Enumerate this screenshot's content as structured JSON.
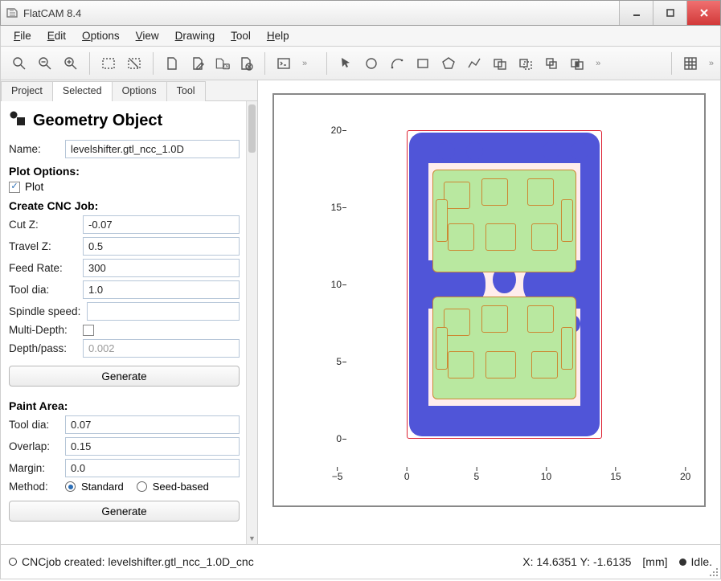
{
  "window": {
    "title": "FlatCAM 8.4"
  },
  "menu": [
    "File",
    "Edit",
    "Options",
    "View",
    "Drawing",
    "Tool",
    "Help"
  ],
  "tabs": {
    "items": [
      "Project",
      "Selected",
      "Options",
      "Tool"
    ],
    "active": 1
  },
  "panel": {
    "heading": "Geometry Object",
    "name_label": "Name:",
    "name_value": "levelshifter.gtl_ncc_1.0D",
    "plot_options": "Plot Options:",
    "plot_checkbox_label": "Plot",
    "plot_checked": true,
    "cnc_heading": "Create CNC Job:",
    "fields": {
      "cutz": {
        "label": "Cut Z:",
        "value": "-0.07"
      },
      "travz": {
        "label": "Travel Z:",
        "value": "0.5"
      },
      "feed": {
        "label": "Feed Rate:",
        "value": "300"
      },
      "tdia": {
        "label": "Tool dia:",
        "value": "1.0"
      },
      "spin": {
        "label": "Spindle speed:",
        "value": ""
      },
      "multi": {
        "label": "Multi-Depth:"
      },
      "dpp": {
        "label": "Depth/pass:",
        "value": "0.002"
      }
    },
    "generate": "Generate",
    "paint_heading": "Paint Area:",
    "paint": {
      "tdia": {
        "label": "Tool dia:",
        "value": "0.07"
      },
      "overlap": {
        "label": "Overlap:",
        "value": "0.15"
      },
      "margin": {
        "label": "Margin:",
        "value": "0.0"
      },
      "method_label": "Method:",
      "method_standard": "Standard",
      "method_seed": "Seed-based",
      "method_selected": "standard"
    },
    "generate2": "Generate"
  },
  "canvas": {
    "x_ticks": [
      -5,
      0,
      5,
      10,
      15,
      20
    ],
    "y_ticks": [
      0,
      5,
      10,
      15,
      20
    ],
    "pcb_extent": {
      "x0": 0,
      "y0": 0,
      "x1": 14,
      "y1": 20
    }
  },
  "status": {
    "message": "CNCjob created: levelshifter.gtl_ncc_1.0D_cnc",
    "coords": "X: 14.6351   Y: -1.6135",
    "units": "[mm]",
    "state": "Idle."
  },
  "toolbar_icons_left": [
    "zoom-fit-icon",
    "zoom-out-icon",
    "zoom-in-icon",
    "select-rect-icon",
    "select-clear-icon",
    "new-doc-icon",
    "edit-doc-icon",
    "doc-ok-icon",
    "doc-del-icon",
    "terminal-icon"
  ],
  "toolbar_icons_right": [
    "pointer-icon",
    "circle-icon",
    "arc-icon",
    "rect-icon",
    "polygon-icon",
    "polyline-icon",
    "union-icon",
    "subtract-icon",
    "copy-icon",
    "intersect-icon"
  ],
  "toolbar_icons_far": [
    "grid-icon"
  ]
}
